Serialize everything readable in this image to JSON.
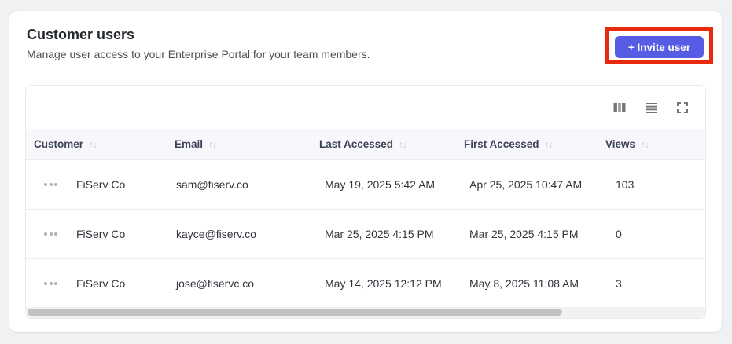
{
  "header": {
    "title": "Customer users",
    "subtitle": "Manage user access to your Enterprise Portal for your team members."
  },
  "invite_button": {
    "label": "+ Invite user"
  },
  "annotation": {
    "type": "highlight-box",
    "target": "invite-button",
    "color": "#E8290C"
  },
  "toolbar": {
    "icons": [
      "columns-icon",
      "row-height-icon",
      "fullscreen-icon"
    ]
  },
  "icons": {
    "sort": "↑↓",
    "row_actions": "•••"
  },
  "table": {
    "columns": [
      {
        "label": "Customer",
        "sortable": true
      },
      {
        "label": "Email",
        "sortable": true
      },
      {
        "label": "Last Accessed",
        "sortable": true
      },
      {
        "label": "First Accessed",
        "sortable": true
      },
      {
        "label": "Views",
        "sortable": true
      }
    ],
    "rows": [
      {
        "customer": "FiServ Co",
        "email": "sam@fiserv.co",
        "last_accessed": "May 19, 2025 5:42 AM",
        "first_accessed": "Apr 25, 2025 10:47 AM",
        "views": "103"
      },
      {
        "customer": "FiServ Co",
        "email": "kayce@fiserv.co",
        "last_accessed": "Mar 25, 2025 4:15 PM",
        "first_accessed": "Mar 25, 2025 4:15 PM",
        "views": "0"
      },
      {
        "customer": "FiServ Co",
        "email": "jose@fiservc.co",
        "last_accessed": "May 14, 2025 12:12 PM",
        "first_accessed": "May 8, 2025 11:08 AM",
        "views": "3"
      }
    ],
    "scrollbar": {
      "orientation": "horizontal",
      "thumb_fraction": 0.79
    }
  },
  "colors": {
    "accent": "#575CE4",
    "highlight_box": "#E8290C",
    "page_bg": "#EFF1F3",
    "header_bg": "#F8F8FC"
  }
}
